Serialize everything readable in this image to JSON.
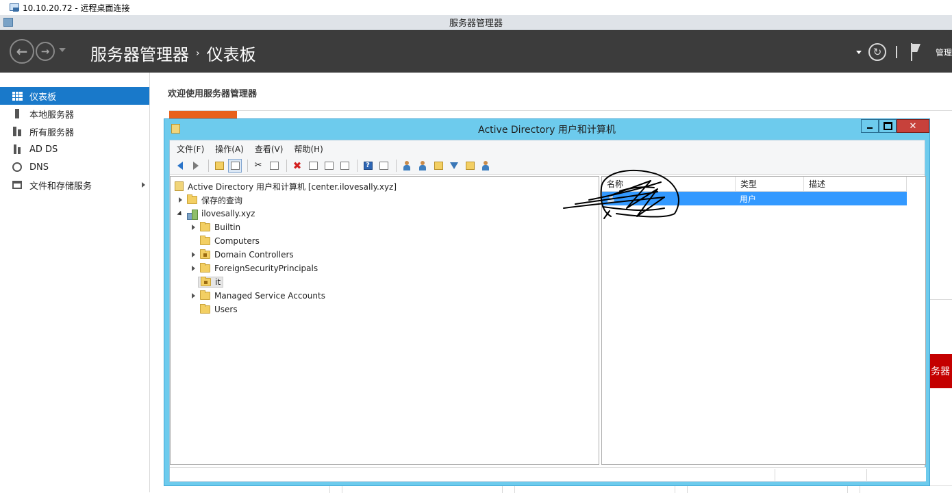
{
  "rdp": {
    "title": "10.10.20.72 - 远程桌面连接"
  },
  "server_manager": {
    "window_title": "服务器管理器",
    "breadcrumb": {
      "root": "服务器管理器",
      "separator": "›",
      "current": "仪表板"
    },
    "header_manage_label": "管理",
    "welcome": "欢迎使用服务器管理器",
    "red_tile_text": "务器",
    "sidebar": {
      "items": [
        {
          "label": "仪表板",
          "icon": "dashboard-icon",
          "active": true
        },
        {
          "label": "本地服务器",
          "icon": "local-server-icon"
        },
        {
          "label": "所有服务器",
          "icon": "all-servers-icon"
        },
        {
          "label": "AD DS",
          "icon": "ad-ds-icon"
        },
        {
          "label": "DNS",
          "icon": "dns-icon"
        },
        {
          "label": "文件和存储服务",
          "icon": "file-storage-icon",
          "has_submenu": true
        }
      ]
    }
  },
  "aduc": {
    "window_title": "Active Directory 用户和计算机",
    "menu": [
      "文件(F)",
      "操作(A)",
      "查看(V)",
      "帮助(H)"
    ],
    "tree": {
      "root": "Active Directory 用户和计算机 [center.ilovesally.xyz]",
      "saved_queries": "保存的查询",
      "domain": "ilovesally.xyz",
      "children": [
        "Builtin",
        "Computers",
        "Domain Controllers",
        "ForeignSecurityPrincipals",
        "it",
        "Managed Service Accounts",
        "Users"
      ]
    },
    "list": {
      "columns": [
        "名称",
        "类型",
        "描述"
      ],
      "rows": [
        {
          "name": "",
          "type": "用户",
          "description": ""
        }
      ]
    }
  },
  "colors": {
    "header_bg": "#3c3c3c",
    "sidebar_active": "#1979ca",
    "aduc_frame": "#6dcbed",
    "selection": "#3399ff",
    "orange_accent": "#e8601a",
    "red_tile": "#c40000"
  }
}
